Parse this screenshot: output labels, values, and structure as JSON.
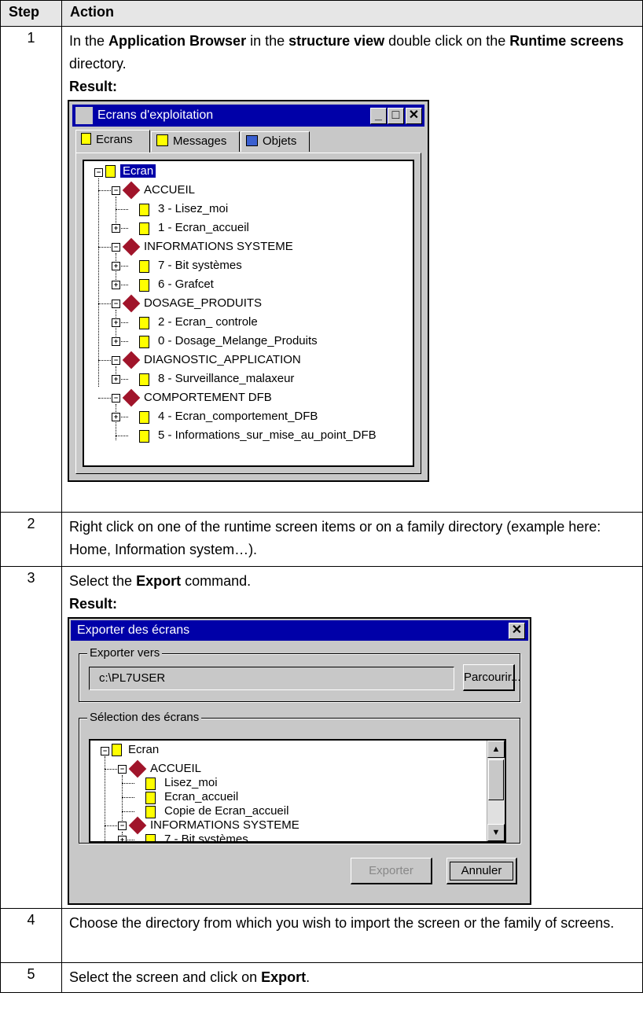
{
  "table": {
    "header_step": "Step",
    "header_action": "Action",
    "rows": [
      {
        "step": "1",
        "t1": "In the ",
        "b1": "Application Browser",
        "t2": " in the ",
        "b2": "structure view",
        "t3": " double click on the ",
        "b3": "Runtime screens",
        "t4": " directory.",
        "result": "Result:"
      },
      {
        "step": "2",
        "text": "Right click on one of the runtime screen items or on a family directory (example here: Home, Information system…)."
      },
      {
        "step": "3",
        "t1": "Select the ",
        "b1": "Export",
        "t2": " command.",
        "result": "Result:"
      },
      {
        "step": "4",
        "text": "Choose the directory from which you wish to import the screen or the family of screens."
      },
      {
        "step": "5",
        "t1": "Select the screen and click on ",
        "b1": "Export",
        "t2": "."
      }
    ]
  },
  "window1": {
    "title": "Ecrans d'exploitation",
    "tabs": [
      "Ecrans",
      "Messages",
      "Objets"
    ],
    "root": "Ecran",
    "tree": [
      {
        "level": 1,
        "type": "family",
        "label": "ACCUEIL"
      },
      {
        "level": 2,
        "type": "screen",
        "label": "3 - Lisez_moi"
      },
      {
        "level": 2,
        "type": "screen",
        "label": "1 - Ecran_accueil"
      },
      {
        "level": 1,
        "type": "family",
        "label": "INFORMATIONS SYSTEME"
      },
      {
        "level": 2,
        "type": "screen",
        "label": "7 - Bit systèmes"
      },
      {
        "level": 2,
        "type": "screen",
        "label": "6 - Grafcet"
      },
      {
        "level": 1,
        "type": "family",
        "label": "DOSAGE_PRODUITS"
      },
      {
        "level": 2,
        "type": "screen",
        "label": "2 - Ecran_ controle"
      },
      {
        "level": 2,
        "type": "screen",
        "label": "0 - Dosage_Melange_Produits"
      },
      {
        "level": 1,
        "type": "family",
        "label": "DIAGNOSTIC_APPLICATION"
      },
      {
        "level": 2,
        "type": "screen",
        "label": "8 - Surveillance_malaxeur"
      },
      {
        "level": 1,
        "type": "family",
        "label": "COMPORTEMENT DFB"
      },
      {
        "level": 2,
        "type": "screen",
        "label": "4 - Ecran_comportement_DFB"
      },
      {
        "level": 2,
        "type": "screen",
        "label": "5 - Informations_sur_mise_au_point_DFB"
      }
    ]
  },
  "window2": {
    "title": "Exporter des écrans",
    "export_to_label": "Exporter vers",
    "path_value": "c:\\PL7USER",
    "browse_label": "Parcourir...",
    "selection_label": "Sélection des écrans",
    "root": "Ecran",
    "tree": [
      {
        "level": 1,
        "type": "family",
        "label": "ACCUEIL"
      },
      {
        "level": 2,
        "type": "screen",
        "label": "Lisez_moi"
      },
      {
        "level": 2,
        "type": "screen",
        "label": "Ecran_accueil"
      },
      {
        "level": 2,
        "type": "screen",
        "label": "Copie de Ecran_accueil"
      },
      {
        "level": 1,
        "type": "family",
        "label": "INFORMATIONS SYSTEME"
      },
      {
        "level": 2,
        "type": "screen",
        "label": "7 - Bit systèmes"
      }
    ],
    "export_button": "Exporter",
    "cancel_button": "Annuler"
  },
  "colors": {
    "titlebar": "#0000a8",
    "window_face": "#c8c8c8",
    "header_fill": "#e6e6e6",
    "family_icon": "#a0142a",
    "screen_icon": "#ffff00"
  }
}
